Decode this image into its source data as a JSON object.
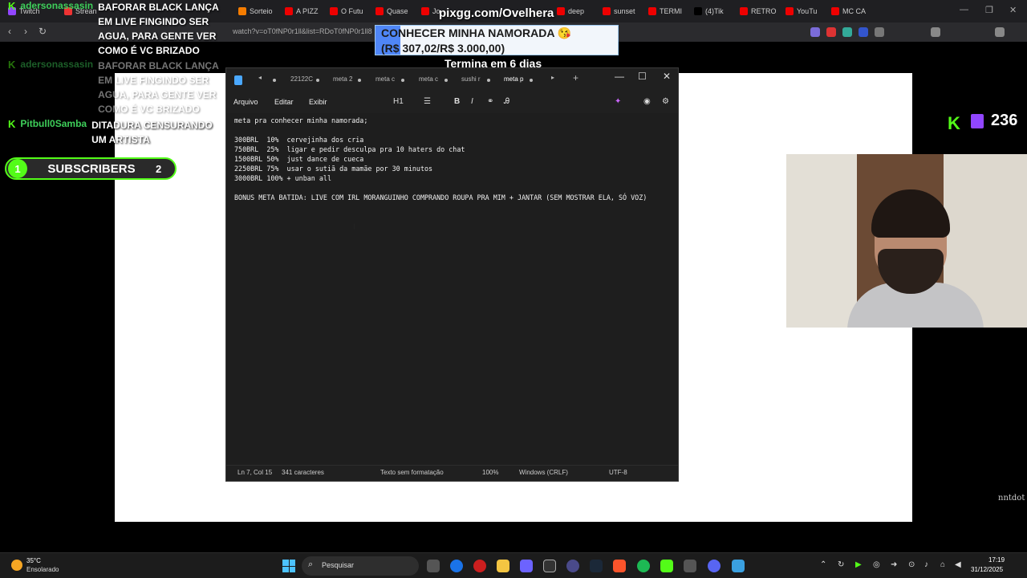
{
  "browser": {
    "tabs": [
      {
        "label": "Twitch",
        "color": "#9146ff",
        "active": false
      },
      {
        "label": "Strean",
        "color": "#e33",
        "active": false
      },
      {
        "label": "Sorteio",
        "color": "#f57c00",
        "active": false
      },
      {
        "label": "A PIZZ",
        "color": "#e00",
        "active": false
      },
      {
        "label": "O Futu",
        "color": "#e00",
        "active": false
      },
      {
        "label": "Quase",
        "color": "#e00",
        "active": false
      },
      {
        "label": "Jo",
        "color": "#e00",
        "active": false
      },
      {
        "label": "deep",
        "color": "#e00",
        "active": false
      },
      {
        "label": "sunset",
        "color": "#e00",
        "active": false
      },
      {
        "label": "TERMI",
        "color": "#e00",
        "active": false
      },
      {
        "label": "(4)Tik",
        "color": "#000",
        "active": false
      },
      {
        "label": "RETRO",
        "color": "#e00",
        "active": false
      },
      {
        "label": "YouTu",
        "color": "#e00",
        "active": false
      },
      {
        "label": "MC CA",
        "color": "#e00",
        "active": false
      }
    ],
    "url": "watch?v=oT0fNP0r1ll&list=RDoT0fNP0r1ll8"
  },
  "chat": [
    {
      "user": "adersonassasin",
      "text": "BAFORAR BLACK LANÇA EM LIVE FINGINDO SER AGUA, PARA GENTE VER COMO É VC BRIZADO",
      "faded": false
    },
    {
      "user": "adersonassasin",
      "text": "BAFORAR BLACK LANÇA EM LIVE FINGINDO SER AGUA, PARA GENTE VER COMO É VC BRIZADO",
      "faded": true
    },
    {
      "user": "Pitbull0Samba",
      "text": "DITADURA CENSURANDO UM ARTISTA",
      "faded": false
    }
  ],
  "subs_bar": {
    "current": "1",
    "label": "SUBSCRIBERS",
    "goal": "2"
  },
  "goal": {
    "site": "pixgg.com/Ovelhera",
    "title": "CONHECER MINHA NAMORADA 😘",
    "amount": "(R$ 307,02/R$ 3.000,00)",
    "progress": 0.1023,
    "ends": "Termina em 6 dias"
  },
  "followers": {
    "count": "236"
  },
  "notepad": {
    "tabs": [
      "22122C",
      "meta 2",
      "meta c",
      "meta c",
      "sushi r",
      "meta p"
    ],
    "menu": [
      "Arquivo",
      "Editar",
      "Exibir"
    ],
    "heading_select": "H1",
    "lines": [
      "meta pra conhecer minha namorada;",
      "",
      "300BRL  10%  cervejinha dos cria",
      "750BRL  25%  ligar e pedir desculpa pra 10 haters do chat",
      "1500BRL 50%  just dance de cueca",
      "2250BRL 75%  usar o sutiã da mamãe por 30 minutos",
      "3000BRL 100% + unban all",
      "",
      "BONUS META BATIDA: LIVE COM IRL MORANGUINHO COMPRANDO ROUPA PRA MIM + JANTAR (SEM MOSTRAR ELA, SÓ VOZ)"
    ],
    "status": {
      "position": "Ln 7, Col 15",
      "chars": "341 caracteres",
      "format": "Texto sem formatação",
      "zoom": "100%",
      "line_ending": "Windows (CRLF)",
      "encoding": "UTF-8"
    }
  },
  "watermark": "nntdot",
  "taskbar": {
    "weather_temp": "35°C",
    "weather_desc": "Ensolarado",
    "search_placeholder": "Pesquisar",
    "time": "17:19",
    "date": "31/12/2025"
  }
}
